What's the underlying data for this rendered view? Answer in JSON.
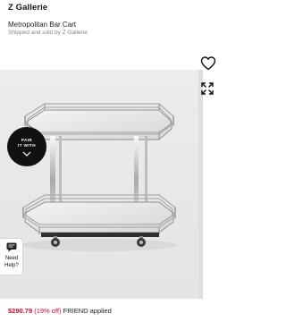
{
  "header": {
    "brand": "Z Gallerie",
    "product_name": "Metropolitan Bar Cart",
    "seller": "Shipped and sold by Z Gallerie"
  },
  "badge": {
    "line1": "PAIR",
    "line2": "IT WITH",
    "icon": "chevron-down-icon"
  },
  "help": {
    "line1": "Need",
    "line2": "Help?",
    "icon": "chat-bubble-icon"
  },
  "side_actions": {
    "favorite_icon": "heart-icon",
    "expand_icon": "expand-icon"
  },
  "pricing": {
    "price": "$290.79",
    "discount": "(19% off)",
    "promo": "FRIEND applied"
  },
  "colors": {
    "price": "#c8102e",
    "badge": "#111111",
    "photo_background": "#ececec"
  }
}
